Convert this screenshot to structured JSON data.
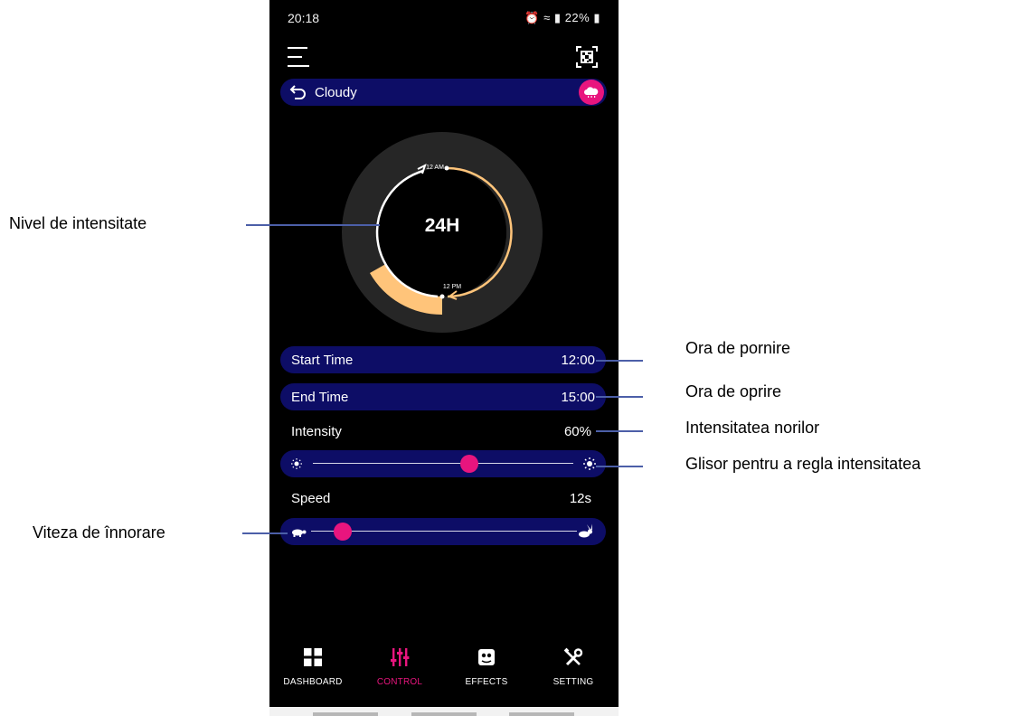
{
  "status_bar": {
    "time": "20:18",
    "battery": "22%"
  },
  "header": {
    "title": "Cloudy"
  },
  "dial": {
    "center_label": "24H",
    "top_label": "12 AM",
    "bottom_label": "12 PM"
  },
  "schedule": {
    "start": {
      "label": "Start Time",
      "value": "12:00"
    },
    "end": {
      "label": "End Time",
      "value": "15:00"
    }
  },
  "intensity": {
    "label": "Intensity",
    "value": "60%",
    "level": 0.6
  },
  "speed": {
    "label": "Speed",
    "value": "12s",
    "level": 0.12
  },
  "tabs": [
    {
      "label": "DASHBOARD",
      "icon": "grid-icon",
      "active": false
    },
    {
      "label": "CONTROL",
      "icon": "sliders-icon",
      "active": true
    },
    {
      "label": "EFFECTS",
      "icon": "effects-icon",
      "active": false
    },
    {
      "label": "SETTING",
      "icon": "tools-icon",
      "active": false
    }
  ],
  "annotations": {
    "intensity_level": "Nivel de intensitate",
    "start_time": "Ora de pornire",
    "end_time": "Ora de oprire",
    "cloud_intensity": "Intensitatea norilor",
    "intensity_slider": "Glisor pentru a regla intensitatea",
    "cloud_speed": "Viteza de înnorare"
  },
  "colors": {
    "accent": "#e8157e",
    "panel": "#0d0d66",
    "arc": "#ffc47a",
    "ring": "#262626",
    "leader": "#4c5fa8"
  }
}
